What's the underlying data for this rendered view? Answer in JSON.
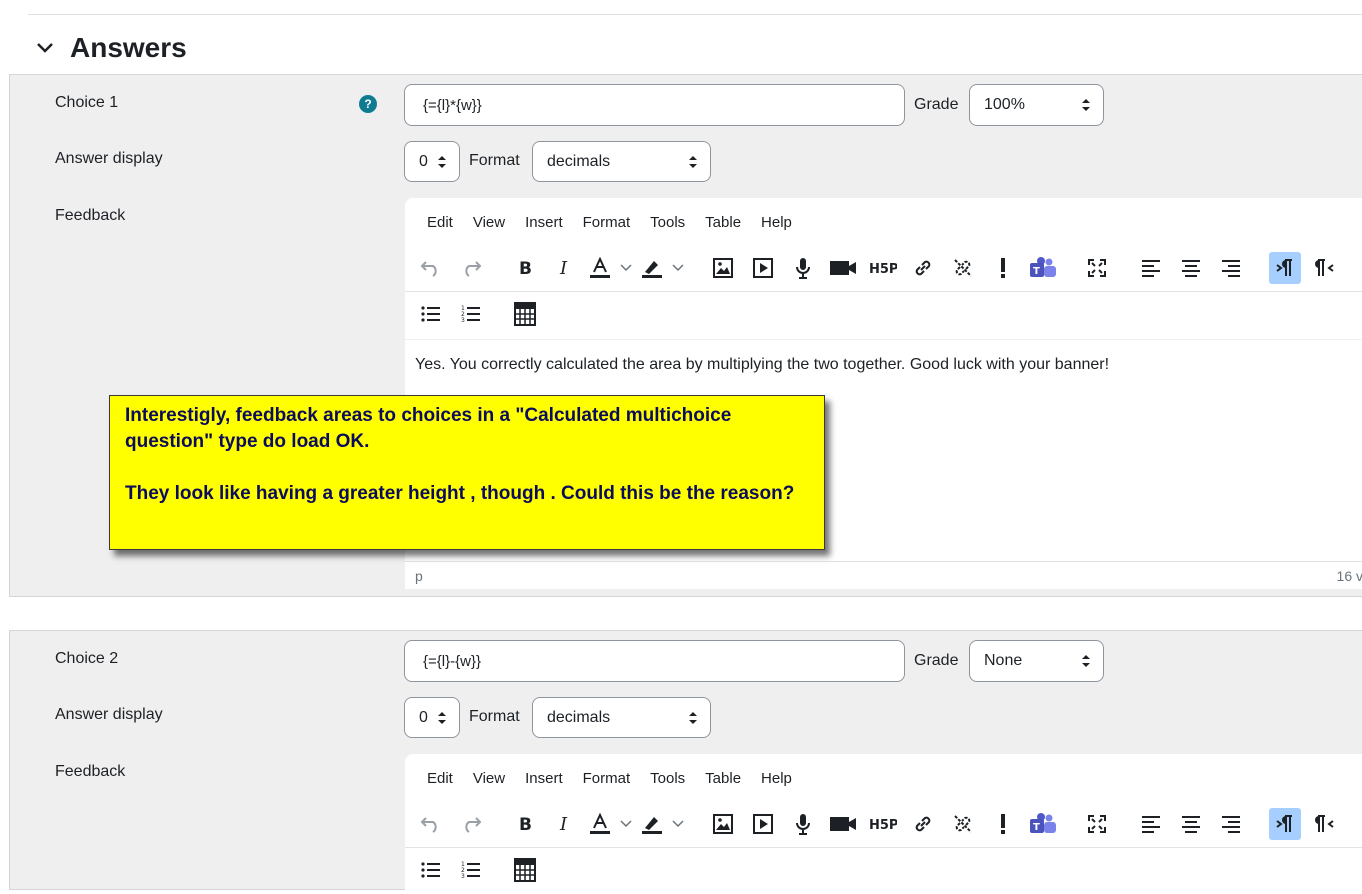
{
  "section": {
    "title": "Answers"
  },
  "editor_menu": [
    "Edit",
    "View",
    "Insert",
    "Format",
    "Tools",
    "Table",
    "Help"
  ],
  "choices": [
    {
      "label": "Choice 1",
      "formula": "{={l}*{w}}",
      "grade_label": "Grade",
      "grade": "100%",
      "answer_display_label": "Answer display",
      "answer_display": "0",
      "format_label": "Format",
      "format": "decimals",
      "feedback_label": "Feedback",
      "feedback_text": "Yes. You correctly calculated the area by multiplying the two together. Good luck with your banner!",
      "status_path": "p",
      "word_count": "16 v"
    },
    {
      "label": "Choice 2",
      "formula": "{={l}-{w}}",
      "grade_label": "Grade",
      "grade": "None",
      "answer_display_label": "Answer display",
      "answer_display": "0",
      "format_label": "Format",
      "format": "decimals",
      "feedback_label": "Feedback"
    }
  ],
  "callout": {
    "line1": "Interestigly, feedback areas to choices in a \"Calculated multichoice question\" type do load OK.",
    "line2": "They look like having a greater height , though . Could this be the reason?"
  },
  "colors": {
    "help": "#0e7b91",
    "callout_bg": "#ffff00",
    "callout_text": "#0c0c5c",
    "active_button": "#a6cfff",
    "block_bg": "#efefef",
    "teams": "#5059c9"
  }
}
